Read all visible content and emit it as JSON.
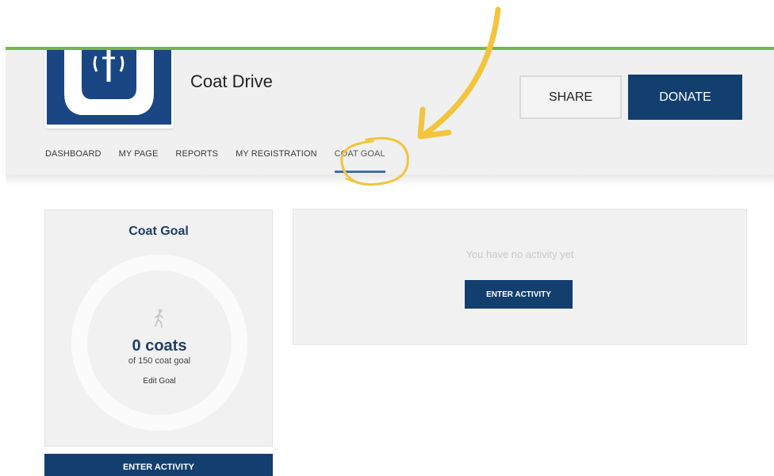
{
  "header": {
    "title": "Coat Drive",
    "share_label": "SHARE",
    "donate_label": "DONATE",
    "accent_color": "#7ab648",
    "brand_color": "#123f6e"
  },
  "nav": {
    "items": [
      {
        "label": "DASHBOARD"
      },
      {
        "label": "MY PAGE"
      },
      {
        "label": "REPORTS"
      },
      {
        "label": "MY REGISTRATION"
      },
      {
        "label": "COAT GOAL",
        "active": true
      }
    ]
  },
  "goal_card": {
    "title": "Coat Goal",
    "icon": "walking-person-icon",
    "count": "0 coats",
    "goal_text": "of 150 coat goal",
    "edit_label": "Edit Goal",
    "progress": 0,
    "button_label": "ENTER ACTIVITY"
  },
  "activity_panel": {
    "empty_text": "You have no activity yet",
    "button_label": "ENTER ACTIVITY"
  },
  "annotation": {
    "color": "#f2c53d",
    "icon": "arrow-annotation"
  }
}
